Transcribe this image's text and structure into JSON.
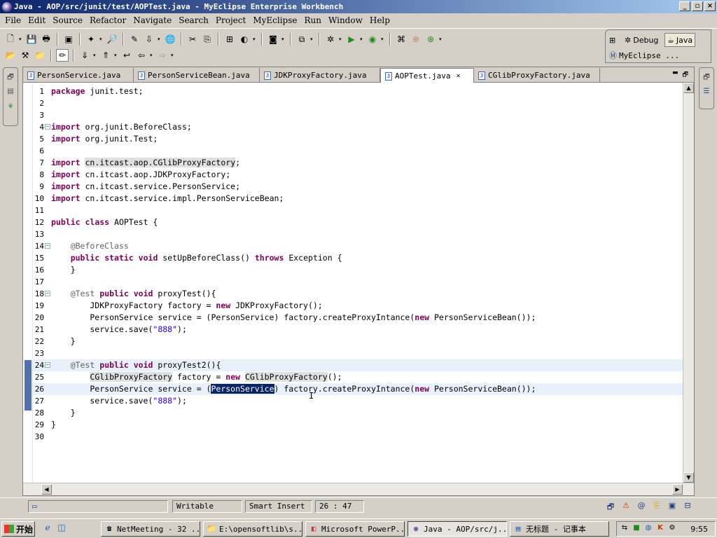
{
  "window": {
    "title": "Java - AOP/src/junit/test/AOPTest.java - MyEclipse Enterprise Workbench",
    "controls": {
      "minimize": "_",
      "maximize": "▫",
      "close": "×"
    }
  },
  "menu": [
    "File",
    "Edit",
    "Source",
    "Refactor",
    "Navigate",
    "Search",
    "Project",
    "MyEclipse",
    "Run",
    "Window",
    "Help"
  ],
  "perspectives": {
    "debug": "Debug",
    "java": "Java",
    "myeclipse": "MyEclipse ..."
  },
  "tabs": [
    {
      "label": "PersonService.java"
    },
    {
      "label": "PersonServiceBean.java"
    },
    {
      "label": "JDKProxyFactory.java"
    },
    {
      "label": "AOPTest.java",
      "active": true
    },
    {
      "label": "CGlibProxyFactory.java"
    }
  ],
  "code": {
    "lines": [
      [
        {
          "t": "package",
          "c": "kw"
        },
        {
          "t": " junit.test;"
        }
      ],
      [],
      [],
      [
        {
          "t": "import",
          "c": "kw"
        },
        {
          "t": " org.junit.BeforeClass;"
        }
      ],
      [
        {
          "t": "import",
          "c": "kw"
        },
        {
          "t": " org.junit.Test;"
        }
      ],
      [],
      [
        {
          "t": "import",
          "c": "kw"
        },
        {
          "t": " "
        },
        {
          "t": "cn.itcast.aop.CGlibProxyFactory",
          "c": "hl"
        },
        {
          "t": ";"
        }
      ],
      [
        {
          "t": "import",
          "c": "kw"
        },
        {
          "t": " cn.itcast.aop.JDKProxyFactory;"
        }
      ],
      [
        {
          "t": "import",
          "c": "kw"
        },
        {
          "t": " cn.itcast.service.PersonService;"
        }
      ],
      [
        {
          "t": "import",
          "c": "kw"
        },
        {
          "t": " cn.itcast.service.impl.PersonServiceBean;"
        }
      ],
      [],
      [
        {
          "t": "public",
          "c": "kw"
        },
        {
          "t": " "
        },
        {
          "t": "class",
          "c": "kw"
        },
        {
          "t": " AOPTest {"
        }
      ],
      [],
      [
        {
          "t": "    "
        },
        {
          "t": "@BeforeClass",
          "c": "ann"
        }
      ],
      [
        {
          "t": "    "
        },
        {
          "t": "public",
          "c": "kw"
        },
        {
          "t": " "
        },
        {
          "t": "static",
          "c": "kw"
        },
        {
          "t": " "
        },
        {
          "t": "void",
          "c": "kw"
        },
        {
          "t": " setUpBeforeClass() "
        },
        {
          "t": "throws",
          "c": "kw"
        },
        {
          "t": " Exception {"
        }
      ],
      [
        {
          "t": "    }"
        }
      ],
      [],
      [
        {
          "t": "    "
        },
        {
          "t": "@Test",
          "c": "ann"
        },
        {
          "t": " "
        },
        {
          "t": "public",
          "c": "kw"
        },
        {
          "t": " "
        },
        {
          "t": "void",
          "c": "kw"
        },
        {
          "t": " proxyTest(){"
        }
      ],
      [
        {
          "t": "        JDKProxyFactory factory = "
        },
        {
          "t": "new",
          "c": "kw"
        },
        {
          "t": " JDKProxyFactory();"
        }
      ],
      [
        {
          "t": "        PersonService service = (PersonService) factory.createProxyIntance("
        },
        {
          "t": "new",
          "c": "kw"
        },
        {
          "t": " PersonServiceBean());"
        }
      ],
      [
        {
          "t": "        service.save("
        },
        {
          "t": "\"888\"",
          "c": "str"
        },
        {
          "t": ");"
        }
      ],
      [
        {
          "t": "    }"
        }
      ],
      [],
      [
        {
          "t": "    "
        },
        {
          "t": "@Test",
          "c": "ann"
        },
        {
          "t": " "
        },
        {
          "t": "public",
          "c": "kw"
        },
        {
          "t": " "
        },
        {
          "t": "void",
          "c": "kw"
        },
        {
          "t": " proxyTest2(){"
        }
      ],
      [
        {
          "t": "        "
        },
        {
          "t": "CGlibProxyFactory",
          "c": "hl"
        },
        {
          "t": " factory = "
        },
        {
          "t": "new",
          "c": "kw"
        },
        {
          "t": " "
        },
        {
          "t": "CGlibProxyFactory",
          "c": "hl"
        },
        {
          "t": "();"
        }
      ],
      [
        {
          "t": "        PersonService service = ("
        },
        {
          "t": "PersonService",
          "c": "sel"
        },
        {
          "t": ") factory.createProxyIntance("
        },
        {
          "t": "new",
          "c": "kw"
        },
        {
          "t": " PersonServiceBean());"
        }
      ],
      [
        {
          "t": "        service.save("
        },
        {
          "t": "\"888\"",
          "c": "str"
        },
        {
          "t": ");"
        }
      ],
      [
        {
          "t": "    }"
        }
      ],
      [
        {
          "t": "}"
        }
      ],
      []
    ],
    "fold_lines": [
      4,
      14,
      18,
      24
    ],
    "current_lines": [
      24,
      26
    ]
  },
  "status": {
    "writable": "Writable",
    "insert_mode": "Smart Insert",
    "position": "26 : 47"
  },
  "taskbar": {
    "start": "开始",
    "tasks": [
      {
        "label": "NetMeeting - 32 ..."
      },
      {
        "label": "E:\\opensoftlib\\s..."
      },
      {
        "label": "Microsoft PowerP..."
      },
      {
        "label": "Java - AOP/src/j...",
        "active": true
      },
      {
        "label": "无标题 - 记事本"
      }
    ],
    "clock": "9:55"
  }
}
